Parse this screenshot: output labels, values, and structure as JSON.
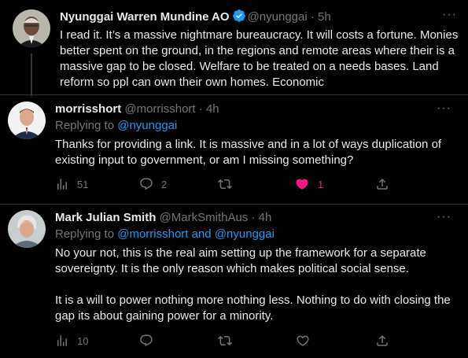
{
  "tweets": [
    {
      "name": "Nyunggai Warren Mundine AO",
      "handle": "@nyunggai",
      "dot": "·",
      "time": "5h",
      "verified": true,
      "text": "I read it. It’s a massive nightmare bureaucracy. It will costs a fortune. Monies better spent on the ground, in the regions and remote areas where their is a massive gap to be closed. Welfare to be treated on a needs bases. Land reform so ppl can own their own homes. Economic"
    },
    {
      "name": "morrisshort",
      "handle": "@morrisshort",
      "dot": "·",
      "time": "4h",
      "replying_prefix": "Replying to ",
      "replying_to": "@nyunggai",
      "text": "Thanks for providing a link. It is massive and in a lot of ways duplication of existing input to government, or am I missing something?",
      "views": "51",
      "replies": "2",
      "retweets": "",
      "likes": "1",
      "liked": true
    },
    {
      "name": "Mark Julian Smith",
      "handle": "@MarkSmithAus",
      "dot": "·",
      "time": "4h",
      "replying_prefix": "Replying to ",
      "replying_to": "@morrisshort and @nyunggai",
      "text": "No your not, this is the real aim setting up the framework for a separate sovereignty. It is the only reason which makes political social sense.\n\nIt is a will to power nothing more nothing less. Nothing to do with closing the gap its about gaining power for a minority.",
      "views": "10",
      "replies": "",
      "retweets": "",
      "likes": ""
    }
  ],
  "more_label": "···",
  "colors": {
    "background": "#000000",
    "text": "#e7e9ea",
    "muted": "#71767b",
    "link": "#1d9bf0",
    "like": "#f91880",
    "verified": "#1d9bf0"
  },
  "icons": [
    "views-icon",
    "reply-icon",
    "retweet-icon",
    "like-icon",
    "share-icon",
    "verified-icon",
    "more-icon"
  ]
}
